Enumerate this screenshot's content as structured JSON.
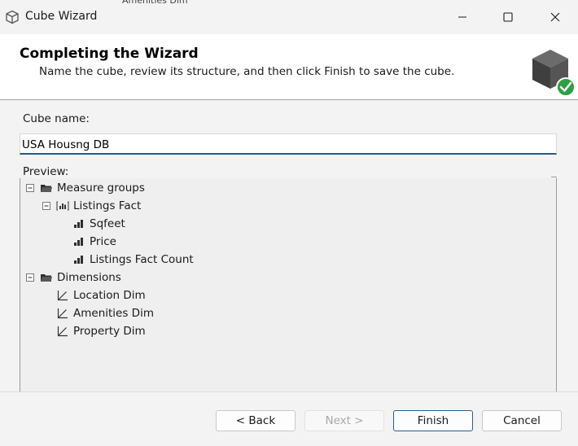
{
  "window": {
    "title": "Cube Wizard",
    "background_tab_text": "Amenities Dim"
  },
  "header": {
    "title": "Completing the Wizard",
    "subtitle": "Name the cube, review its structure, and then click Finish to save the cube.",
    "icon": "cube-check-icon"
  },
  "form": {
    "cube_name_label": "Cube name:",
    "cube_name_value": "USA Housng DB",
    "preview_label": "Preview:"
  },
  "tree": {
    "measure_groups": "Measure groups",
    "listings_fact": "Listings Fact",
    "measures": [
      "Sqfeet",
      "Price",
      "Listings Fact Count"
    ],
    "dimensions_label": "Dimensions",
    "dimensions": [
      "Location Dim",
      "Amenities Dim",
      "Property Dim"
    ]
  },
  "buttons": {
    "back": "< Back",
    "next": "Next >",
    "finish": "Finish",
    "cancel": "Cancel"
  },
  "colors": {
    "accent": "#1f5d8c",
    "check_green": "#2e9e43",
    "window_bg": "#f3f3f3"
  }
}
